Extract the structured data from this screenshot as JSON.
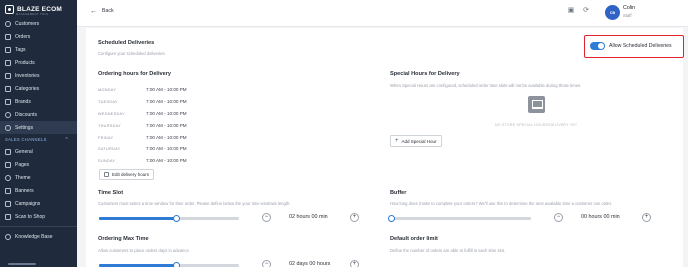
{
  "brand": {
    "name": "BLAZE ECOM",
    "tagline": "MANAGEMENT TOOL"
  },
  "sidebar": {
    "items": [
      {
        "label": "Customers",
        "icon": "users-icon"
      },
      {
        "label": "Orders",
        "icon": "cart-icon"
      },
      {
        "label": "Tags",
        "icon": "tag-icon"
      },
      {
        "label": "Products",
        "icon": "box-icon"
      },
      {
        "label": "Inventories",
        "icon": "clipboard-icon"
      },
      {
        "label": "Categories",
        "icon": "grid-icon"
      },
      {
        "label": "Brands",
        "icon": "brand-icon"
      },
      {
        "label": "Discounts",
        "icon": "percent-icon"
      },
      {
        "label": "Settings",
        "icon": "gear-icon",
        "active": true
      }
    ],
    "section_title": "SALES CHANNELS",
    "channel_items": [
      {
        "label": "General",
        "icon": "store-icon"
      },
      {
        "label": "Pages",
        "icon": "page-icon"
      },
      {
        "label": "Theme",
        "icon": "palette-icon"
      },
      {
        "label": "Banners",
        "icon": "image-icon"
      },
      {
        "label": "Campaigns",
        "icon": "megaphone-icon"
      },
      {
        "label": "Scan to Shop",
        "icon": "qr-icon"
      }
    ],
    "knowledge_base": "Knowledge Base"
  },
  "topbar": {
    "back_label": "Back",
    "user_initials": "CB",
    "user_name": "Colin",
    "user_role": "Staff"
  },
  "scheduled": {
    "title": "Scheduled Deliveries",
    "subtitle": "Configure your scheduled deliveries.",
    "toggle_label": "Allow Scheduled Deliveries",
    "toggle_on": true
  },
  "ordering_hours": {
    "title": "Ordering hours for Delivery",
    "days": [
      {
        "day": "MONDAY",
        "hours": "7:00 AM - 10:00 PM"
      },
      {
        "day": "TUESDAY",
        "hours": "7:00 AM - 10:00 PM"
      },
      {
        "day": "WEDNESDAY",
        "hours": "7:00 AM - 10:00 PM"
      },
      {
        "day": "THURSDAY",
        "hours": "7:00 AM - 10:00 PM"
      },
      {
        "day": "FRIDAY",
        "hours": "7:00 AM - 10:00 PM"
      },
      {
        "day": "SATURDAY",
        "hours": "7:00 AM - 10:00 PM"
      },
      {
        "day": "SUNDAY",
        "hours": "7:00 AM - 10:00 PM"
      }
    ],
    "edit_button": "Edit delivery hours"
  },
  "special_hours": {
    "title": "Special Hours for Delivery",
    "description": "When Special Hours are configured, scheduled order time slots will not be available during those times.",
    "empty_text": "NO STORE SPECIAL HOURS/DELIVERY YET",
    "add_button": "Add Special Hour"
  },
  "time_slot": {
    "title": "Time Slot",
    "description": "Customers must select a time window for their order. Please define below the your time windows length.",
    "value": "02 hours 00 min",
    "slider_fraction": 0.55
  },
  "buffer": {
    "title": "Buffer",
    "description": "How long does it take to complete your orders? We'll use this to determine the next available time a customer can order.",
    "value": "00 hours 00 min",
    "slider_fraction": 0.0
  },
  "ordering_max_time": {
    "title": "Ordering Max Time",
    "description": "Allow customers to place orders days in advance.",
    "value": "02 days 00 hours",
    "slider_fraction": 0.55
  },
  "default_order_limit": {
    "title": "Default order limit",
    "description": "Define the number of orders are able to fulfill in each time slot."
  },
  "colors": {
    "sidebar_bg": "#1f2a3c",
    "accent": "#2f7bd6",
    "highlight_border": "#e0242b"
  }
}
